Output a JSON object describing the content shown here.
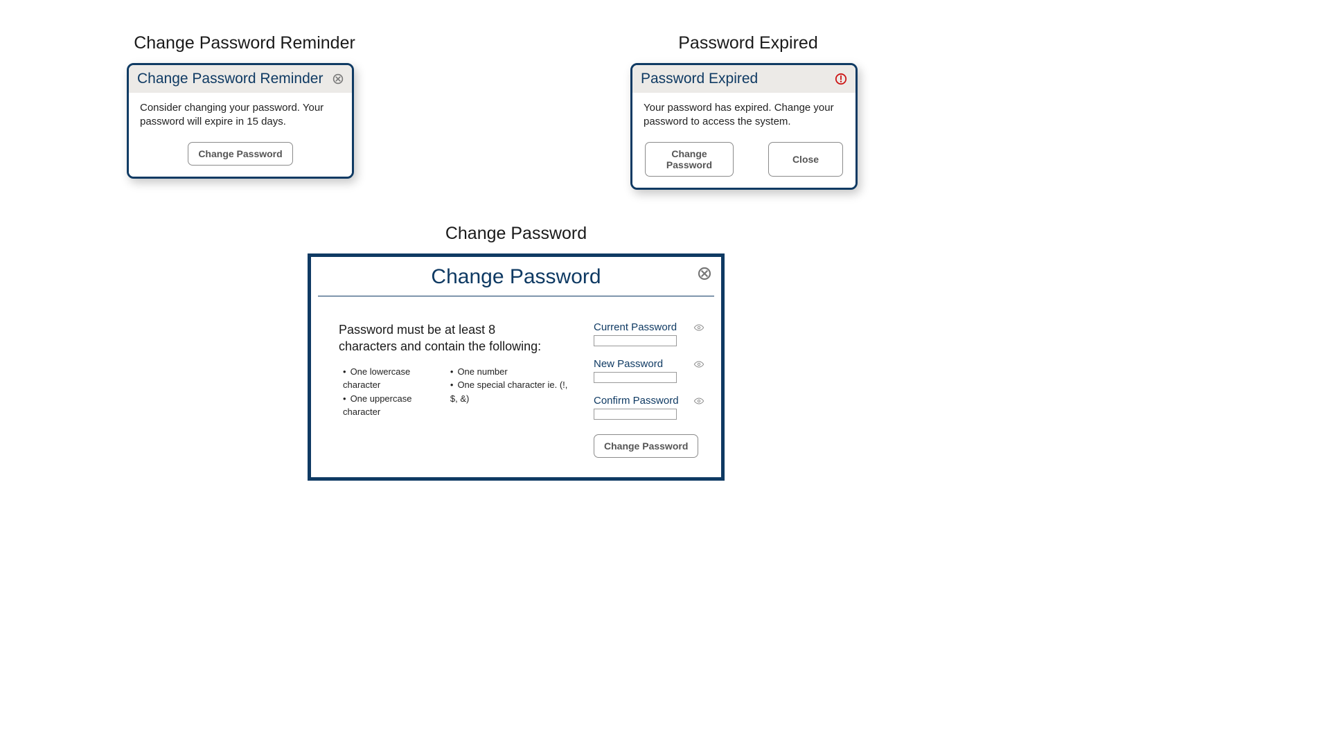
{
  "reminder": {
    "section_title": "Change Password Reminder",
    "dialog_title": "Change Password Reminder",
    "body_text": "Consider changing your password. Your password will expire in 15 days.",
    "change_button": "Change Password"
  },
  "expired": {
    "section_title": "Password Expired",
    "dialog_title": "Password Expired",
    "body_text": "Your password has expired. Change your password to access the system.",
    "change_button": "Change Password",
    "close_button": "Close"
  },
  "change": {
    "section_title": "Change Password",
    "dialog_title": "Change Password",
    "rules_intro": "Password must be at least 8 characters and contain the following:",
    "rules_col1": {
      "r0": "One lowercase character",
      "r1": "One uppercase character"
    },
    "rules_col2": {
      "r0": "One number",
      "r1": "One special character ie. (!, $, &)"
    },
    "fields": {
      "current": {
        "label": "Current Password"
      },
      "new": {
        "label": "New Password"
      },
      "confirm": {
        "label": "Confirm Password"
      }
    },
    "submit_button": "Change Password"
  },
  "colors": {
    "primary": "#0f3a63",
    "alert": "#cc1414",
    "icon_gray": "#777777"
  }
}
